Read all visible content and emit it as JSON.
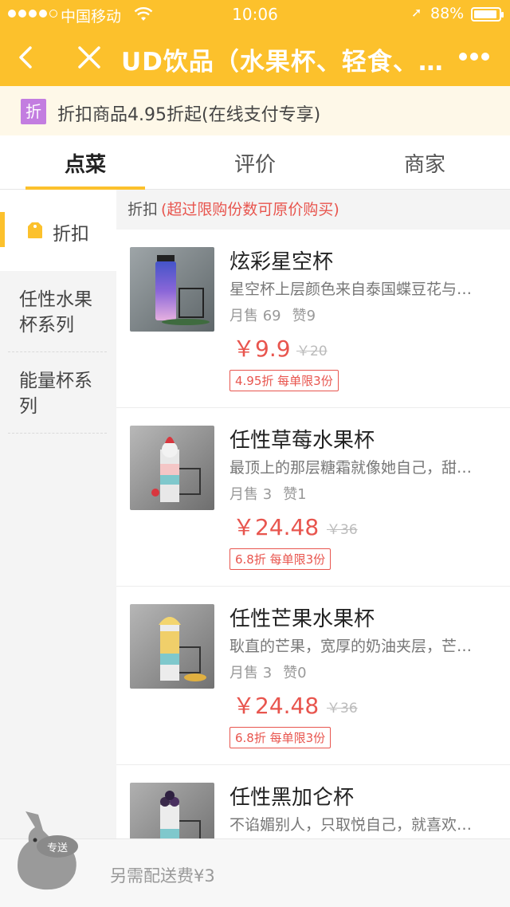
{
  "status_bar": {
    "carrier": "中国移动",
    "time": "10:06",
    "battery": "88%"
  },
  "nav": {
    "title": "UD饮品（水果杯、轻食、…"
  },
  "promo": {
    "badge": "折",
    "text": "折扣商品4.95折起(在线支付专享)"
  },
  "tabs": [
    "点菜",
    "评价",
    "商家"
  ],
  "sidebar": {
    "items": [
      {
        "label": "折扣"
      },
      {
        "label": "任性水果杯系列"
      },
      {
        "label": "能量杯系列"
      }
    ]
  },
  "section": {
    "title": "折扣",
    "note": "(超过限购份数可原价购买)"
  },
  "products": [
    {
      "name": "炫彩星空杯",
      "desc": "星空杯上层颜色来自泰国蝶豆花与…",
      "monthly_sales": "月售 69",
      "likes": "赞9",
      "price": "￥9.9",
      "original_price": "￥20",
      "discount": "4.95折 每单限3份"
    },
    {
      "name": "任性草莓水果杯",
      "desc": "最顶上的那层糖霜就像她自己，甜…",
      "monthly_sales": "月售 3",
      "likes": "赞1",
      "price": "￥24.48",
      "original_price": "￥36",
      "discount": "6.8折 每单限3份"
    },
    {
      "name": "任性芒果水果杯",
      "desc": "耿直的芒果，宽厚的奶油夹层，芒…",
      "monthly_sales": "月售 3",
      "likes": "赞0",
      "price": "￥24.48",
      "original_price": "￥36",
      "discount": "6.8折 每单限3份"
    },
    {
      "name": "任性黑加仑杯",
      "desc": "不谄媚别人，只取悦自己，就喜欢…"
    }
  ],
  "cart": {
    "delivery_fee": "另需配送费¥3",
    "mascot_label": "专送"
  },
  "colors": {
    "brand": "#fcc12c",
    "price": "#e8554e",
    "promo_badge": "#c37de0"
  }
}
